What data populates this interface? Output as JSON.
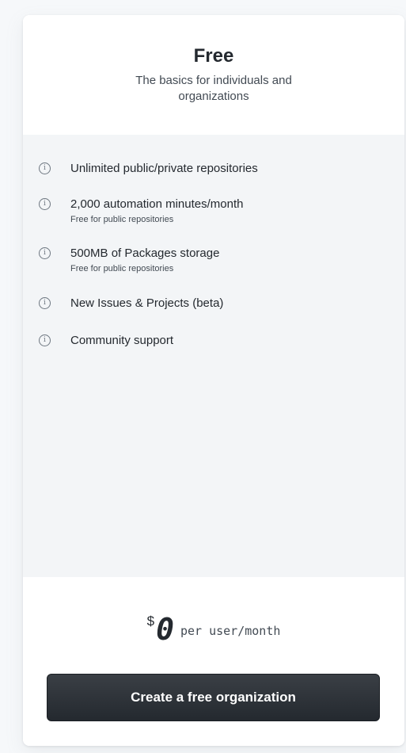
{
  "plan": {
    "name": "Free",
    "description": "The basics for individuals and organizations"
  },
  "features": [
    {
      "icon": "info-icon",
      "title": "Unlimited public/private repositories",
      "subtitle": ""
    },
    {
      "icon": "info-icon",
      "title": "2,000 automation minutes/month",
      "subtitle": "Free for public repositories"
    },
    {
      "icon": "info-icon",
      "title": "500MB of Packages storage",
      "subtitle": "Free for public repositories"
    },
    {
      "icon": "info-icon",
      "title": "New Issues & Projects (beta)",
      "subtitle": ""
    },
    {
      "icon": "info-icon",
      "title": "Community support",
      "subtitle": ""
    }
  ],
  "info_glyph": "i",
  "pricing": {
    "currency": "$",
    "amount": "0",
    "period": "per user/month"
  },
  "cta": {
    "label": "Create a free organization"
  },
  "colors": {
    "text": "#24292f",
    "features_bg": "#f3f5f7",
    "button_bg": "#24292f",
    "button_text": "#ffffff"
  }
}
